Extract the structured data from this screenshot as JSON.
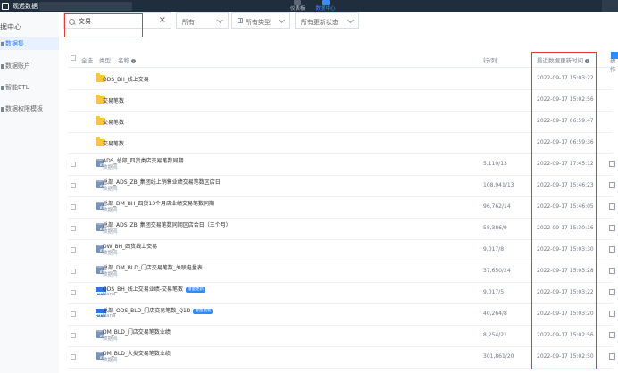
{
  "app": {
    "brand": "观远数据"
  },
  "topnav": [
    {
      "label": "仪表板"
    },
    {
      "label": "数据中心"
    }
  ],
  "sidebar": {
    "title": "据中心",
    "items": [
      {
        "label": "数据集"
      },
      {
        "label": "数据账户"
      },
      {
        "label": "智能ETL"
      },
      {
        "label": "数据权限模板"
      }
    ]
  },
  "filters": {
    "search_value": "交易",
    "type_1": "所有",
    "type_2": "所有类型",
    "type_3": "所有更新状态"
  },
  "table": {
    "headers": {
      "select_all": "全选",
      "type": "类型",
      "name": "名称",
      "size": "行/列",
      "time": "最近数据更新时间",
      "op": "操作"
    },
    "rows": [
      {
        "icon": "folder-icon",
        "name": "ODS_BH_线上交易",
        "sub": "",
        "size": "",
        "time": "2022-09-17 15:03:22"
      },
      {
        "icon": "folder-icon",
        "name": "交易笔数",
        "sub": "",
        "size": "",
        "time": "2022-09-17 15:02:56"
      },
      {
        "icon": "folder-icon",
        "name": "交易笔数",
        "sub": "",
        "size": "",
        "time": "2022-09-17 06:59:47"
      },
      {
        "icon": "folder-icon",
        "name": "交易笔数",
        "sub": "",
        "size": "",
        "time": "2022-09-17 06:59:36"
      },
      {
        "icon": "etl-icon",
        "name": "ADS_总部_四货类店交易笔数同期",
        "sub": "数据流",
        "size": "5,110/13",
        "time": "2022-09-17 17:45:12"
      },
      {
        "icon": "etl-icon",
        "name": "总部_ADS_ZB_集团线上销售业绩交易笔数区店日",
        "sub": "数据流",
        "size": "108,941/13",
        "time": "2022-09-17 15:46:23"
      },
      {
        "icon": "etl-icon",
        "name": "总部_DM_BH_四货13个月店业绩交易笔数同期",
        "sub": "数据流",
        "size": "96,762/14",
        "time": "2022-09-17 15:46:05"
      },
      {
        "icon": "etl-icon",
        "name": "总部_ADS_ZB_集团交易笔数同期区店合日（三个月）",
        "sub": "数据流",
        "size": "58,386/9",
        "time": "2022-09-17 15:30:16"
      },
      {
        "icon": "etl-icon",
        "name": "DW_BH_四货线上交易",
        "sub": "数据流",
        "size": "9,017/8",
        "time": "2022-09-17 15:03:30"
      },
      {
        "icon": "etl-icon",
        "name": "总部_DM_BLD_门店交易笔数_关联电量表",
        "sub": "数据流",
        "size": "37,650/24",
        "time": "2022-09-17 15:03:28"
      },
      {
        "icon": "sap-icon",
        "name": "ODS_BH_线上交易业绩-交易笔数",
        "sub": "Hana",
        "tag": "增量更新",
        "size": "9,017/5",
        "time": "2022-09-17 15:03:22"
      },
      {
        "icon": "sap-icon",
        "name": "总部_ODS_BLD_门店交易笔数_Q1D",
        "sub": "Hana",
        "tag": "增量更新",
        "size": "40,264/8",
        "time": "2022-09-17 15:03:20"
      },
      {
        "icon": "etl-icon",
        "name": "DM_BLD_门店交易笔数业绩",
        "sub": "数据流",
        "size": "8,254/21",
        "time": "2022-09-17 15:02:56"
      },
      {
        "icon": "etl-icon",
        "name": "DM_BLD_大类交易笔数业绩",
        "sub": "数据流",
        "size": "301,861/20",
        "time": "2022-09-17 15:02:50"
      }
    ]
  },
  "colors": {
    "accent": "#2f8cff",
    "highlight": "#e53935",
    "topbar": "#1f2d3d"
  }
}
